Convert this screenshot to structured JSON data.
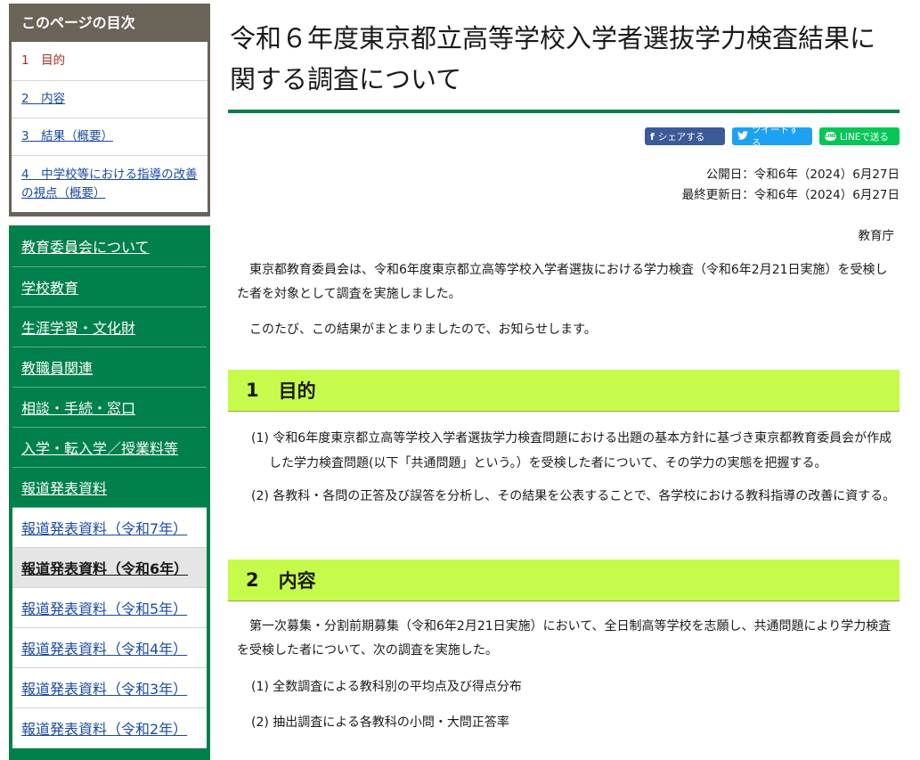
{
  "toc": {
    "title": "このページの目次",
    "items": [
      {
        "label": "1　目的"
      },
      {
        "label": "2　内容"
      },
      {
        "label": "3　結果（概要）"
      },
      {
        "label": "4　中学校等における指導の改善の視点（概要）"
      }
    ]
  },
  "nav": {
    "items": [
      {
        "label": "教育委員会について"
      },
      {
        "label": "学校教育"
      },
      {
        "label": "生涯学習・文化財"
      },
      {
        "label": "教職員関連"
      },
      {
        "label": "相談・手続・窓口"
      },
      {
        "label": "入学・転入学／授業料等"
      },
      {
        "label": "報道発表資料"
      }
    ],
    "sub_items": [
      {
        "label": "報道発表資料（令和7年）"
      },
      {
        "label": "報道発表資料（令和6年）"
      },
      {
        "label": "報道発表資料（令和5年）"
      },
      {
        "label": "報道発表資料（令和4年）"
      },
      {
        "label": "報道発表資料（令和3年）"
      },
      {
        "label": "報道発表資料（令和2年）"
      }
    ]
  },
  "page": {
    "title": "令和６年度東京都立高等学校入学者選抜学力検査結果に関する調査について",
    "share": {
      "facebook": "シェアする",
      "twitter": "ツイートする",
      "line": "LINEで送る",
      "line_icon": "LINE"
    },
    "published": "公開日：令和6年（2024）6月27日",
    "updated": "最終更新日：令和6年（2024）6月27日",
    "department": "教育庁",
    "intro1": "東京都教育委員会は、令和6年度東京都立高等学校入学者選抜における学力検査（令和6年2月21日実施）を受検した者を対象として調査を実施しました。",
    "intro2": "このたび、この結果がまとまりましたので、お知らせします。",
    "section1": {
      "num": "1",
      "title": "目的",
      "items": [
        "(1) 令和6年度東京都立高等学校入学者選抜学力検査問題における出題の基本方針に基づき東京都教育委員会が作成した学力検査問題(以下「共通問題」という。）を受検した者について、その学力の実態を把握する。",
        "(2) 各教科・各問の正答及び誤答を分析し、その結果を公表することで、各学校における教科指導の改善に資する。"
      ]
    },
    "section2": {
      "num": "2",
      "title": "内容",
      "intro": "第一次募集・分割前期募集（令和6年2月21日実施）において、全日制高等学校を志願し、共通問題により学力検査を受検した者について、次の調査を実施した。",
      "items": [
        "(1) 全数調査による教科別の平均点及び得点分布",
        "(2) 抽出調査による各教科の小問・大問正答率"
      ]
    }
  }
}
